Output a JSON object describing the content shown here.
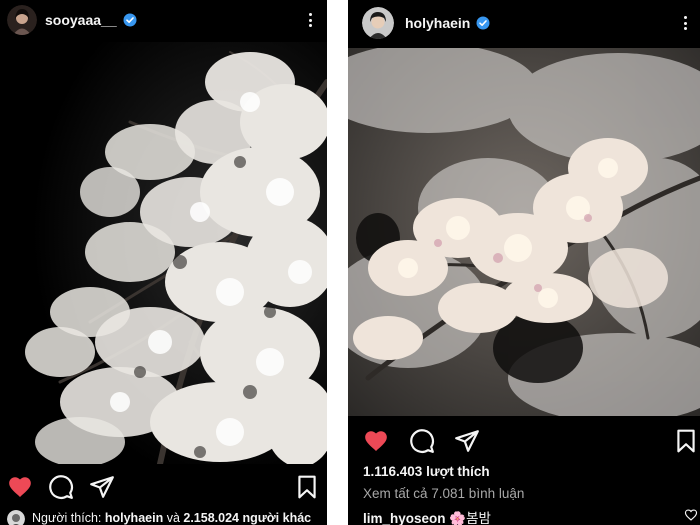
{
  "left_post": {
    "username": "sooyaaa__",
    "liked_by_prefix": "Người thích:",
    "liked_by_user": "holyhaein",
    "liked_by_and": "và",
    "liked_by_rest": "2.158.024 người khác",
    "icons": {
      "avatar": "profile-avatar",
      "verified": "verified-badge-icon",
      "more": "more-options-icon",
      "like": "heart-filled-icon",
      "comment": "comment-icon",
      "share": "send-icon",
      "save": "bookmark-icon"
    }
  },
  "right_post": {
    "username": "holyhaein",
    "likes": "1.116.403 lượt thích",
    "view_comments": "Xem tất cả 7.081 bình luận",
    "comment_user": "lim_hyoseon",
    "comment_text": "🌸봄밤",
    "icons": {
      "avatar": "profile-avatar",
      "verified": "verified-badge-icon",
      "more": "more-options-icon",
      "like": "heart-filled-icon",
      "comment": "comment-icon",
      "share": "send-icon",
      "save": "bookmark-icon",
      "comment_like": "heart-outline-icon"
    }
  },
  "colors": {
    "background": "#000000",
    "like_red": "#ed4956",
    "verified_blue": "#3897f0",
    "text": "#f5f5f5",
    "muted_text": "#a8a8a8",
    "divider": "#ffffff"
  }
}
